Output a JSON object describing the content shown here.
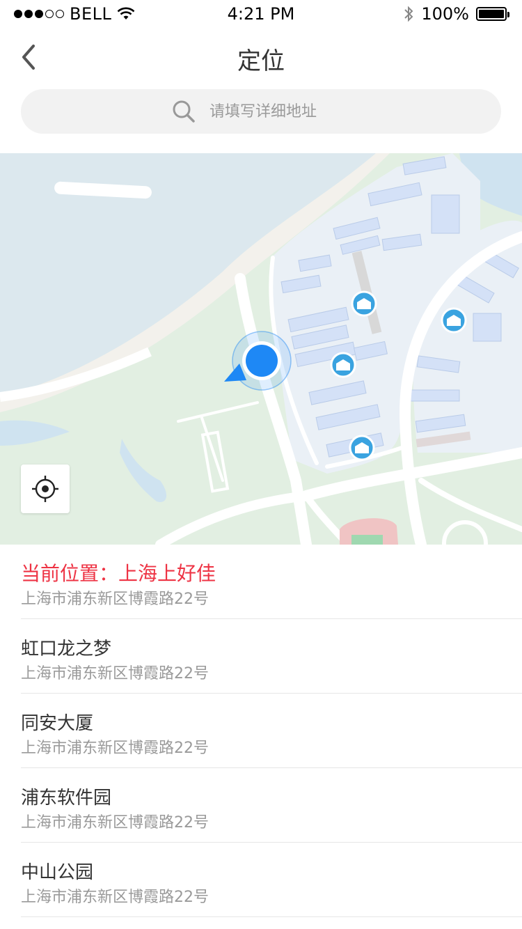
{
  "status_bar": {
    "carrier": "BELL",
    "time": "4:21 PM",
    "battery": "100%"
  },
  "nav": {
    "title": "定位"
  },
  "search": {
    "placeholder": "请填写详细地址"
  },
  "map": {
    "colors": {
      "water": "#dfeaf1",
      "green": "#dfeedf",
      "road": "#ffffff",
      "building": "#d4e1f7",
      "marker": "#1e88f5"
    }
  },
  "list": {
    "current_label": "当前位置：",
    "current_name": "上海上好佳",
    "current_address": "上海市浦东新区博霞路22号",
    "items": [
      {
        "name": "虹口龙之梦",
        "address": "上海市浦东新区博霞路22号"
      },
      {
        "name": "同安大厦",
        "address": "上海市浦东新区博霞路22号"
      },
      {
        "name": "浦东软件园",
        "address": "上海市浦东新区博霞路22号"
      },
      {
        "name": "中山公园",
        "address": "上海市浦东新区博霞路22号"
      }
    ]
  }
}
